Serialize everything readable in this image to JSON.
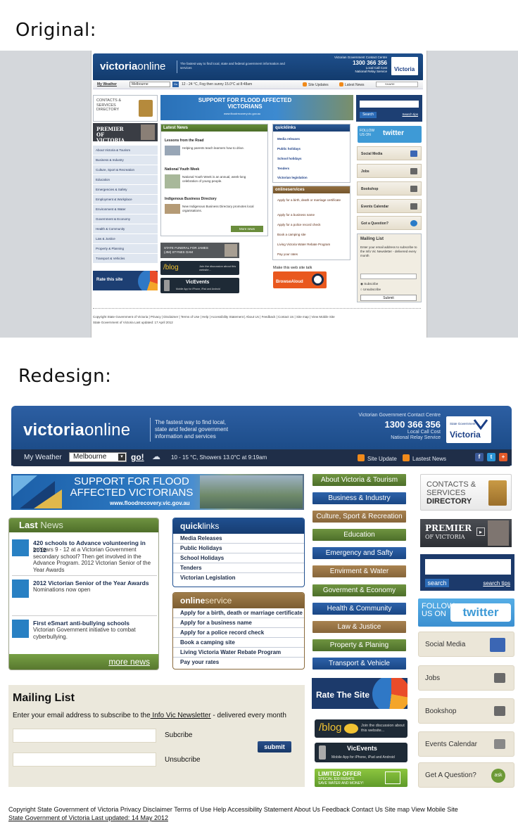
{
  "labels": {
    "original": "Original:",
    "redesign": "Redesign:"
  },
  "original": {
    "logo_bold": "victoria",
    "logo_light": "online",
    "tagline": "The fastest way to find local, state and federal government information and services",
    "contact_title": "Victorian Government Contact Centre",
    "contact_number": "1300 366 356",
    "contact_line1": "Local Call Cost",
    "contact_line2": "National Relay Service",
    "vic_logo": "Victoria",
    "nav": {
      "my_weather": "My Weather",
      "city": "Melbourne",
      "go": "Go",
      "forecast": "12 - 24 °C, Fog then sunny 15.0°C at 8:48am",
      "site_updates": "Site Updates",
      "latest_news": "Latest News",
      "share": "SHARE"
    },
    "contacts_directory": "CONTACTS & SERVICES DIRECTORY",
    "flood_banner": "SUPPORT FOR FLOOD AFFECTED VICTORIANS",
    "flood_url": "www.floodrecovery.vic.gov.au",
    "search_button": "Search",
    "search_tips": "Search tips",
    "premier": "PREMIER OF VICTORIA",
    "left_nav": [
      "About Victoria & Tourism",
      "Business & Industry",
      "Culture, Sport & Recreation",
      "Education",
      "Emergencies & Safety",
      "Employment & Workplace",
      "Environment & Water",
      "Government & Economy",
      "Health & Community",
      "Law & Justice",
      "Property & Planning",
      "Transport & Vehicles"
    ],
    "rate_site": "Rate this site",
    "latest_news_head": "Latest News",
    "news": [
      {
        "title": "Lessons from the Road",
        "body": "Helping parents teach learners how to drive."
      },
      {
        "title": "National Youth Week",
        "body": "National Youth Week is an annual, week-long celebration of young people."
      },
      {
        "title": "Indigenous Business Directory",
        "body": "New Indigenous Business Directory promotes local organisations."
      }
    ],
    "more_news": "More news",
    "state_funeral": "STATE FUNERAL FOR JAMES (JIM) STYNES OAM",
    "blog": "/blog",
    "blog_sub": "Join the discussion about this website...",
    "vicevents": "VicEvents",
    "vicevents_sub": "Mobile App for iPhone, iPad and Android",
    "quicklinks_head": "quicklinks",
    "quicklinks": [
      "Media releases",
      "Public holidays",
      "School holidays",
      "Tenders",
      "Victorian legislation"
    ],
    "onlineservices_head": "onlineservices",
    "onlineservices": [
      "Apply for a birth, death or marriage certificate",
      "Apply for a business name",
      "Apply for a police record check",
      "Book a camping site",
      "Living Victoria Water Rebate Program",
      "Pay your rates"
    ],
    "talk": "Make this web site talk",
    "browsealoud": "BrowseAloud",
    "follow": "FOLLOW US ON",
    "twitter": "twitter",
    "right_items": [
      "Social Media",
      "Jobs",
      "Bookshop",
      "Events Calendar",
      "Got a Question?"
    ],
    "mailing_list_head": "Mailing List",
    "mailing_text": "Enter your email address to subscribe to the Info Vic Newsletter - delivered every month",
    "subscribe": "Subscribe",
    "unsubscribe": "Unsubscribe",
    "submit": "Submit",
    "footer1": "Copyright State Government of Victoria | Privacy | Disclaimer | Terms of Use | Help | Accessibility Statement | About Us | Feedback | Contact Us | Site map | View Mobile Site",
    "footer2": "State Government of Victoria Last updated: 17 April 2012"
  },
  "redesign": {
    "logo_bold": "victoria",
    "logo_light": "online",
    "tagline": "The fastest way to find local, state and federal government information and services",
    "contact_title": "Victorian Government Contact Centre",
    "contact_number": "1300 366 356",
    "contact_line1": "Local Call Cost",
    "contact_line2": "National Relay Service",
    "vic_small": "State Government",
    "vic_logo": "Victoria",
    "nav": {
      "my_weather": "My Weather",
      "city": "Melbourne",
      "go": "go!",
      "forecast": "10 - 15 °C, Showers 13.0°C at 9:19am",
      "site_update": "Site Update",
      "latest_news": "Lastest News"
    },
    "flood_banner_line1": "SUPPORT FOR FLOOD",
    "flood_banner_line2": "AFFECTED VICTORIANS",
    "flood_url": "www.floodrecovery.vic.gov.au",
    "categories": [
      {
        "label": "About Victoria & Tourism",
        "color": "green"
      },
      {
        "label": "Business & Industry",
        "color": "blue"
      },
      {
        "label": "Culture, Sport & Recreation",
        "color": "brown"
      },
      {
        "label": "Education",
        "color": "green"
      },
      {
        "label": "Emergency and Safty",
        "color": "blue"
      },
      {
        "label": "Envirment & Water",
        "color": "brown"
      },
      {
        "label": "Goverment & Economy",
        "color": "green"
      },
      {
        "label": "Health & Community",
        "color": "blue"
      },
      {
        "label": "Law & Justice",
        "color": "brown"
      },
      {
        "label": "Property & Planing",
        "color": "green"
      },
      {
        "label": "Transport & Vehicle",
        "color": "blue"
      }
    ],
    "contacts_directory_line1": "CONTACTS &",
    "contacts_directory_line2": "SERVICES",
    "contacts_directory_line3": "DIRECTORY",
    "premier_line1": "PREMIER",
    "premier_line2": "OF VICTORIA",
    "search_button": "search",
    "search_tips": "search tips",
    "follow_line1": "FOLLOW",
    "follow_line2": "US ON",
    "twitter": "twitter",
    "side_items": [
      "Social Media",
      "Jobs",
      "Bookshop",
      "Events Calendar",
      "Get A Question?"
    ],
    "ask": "ask",
    "last_news_bold": "Last",
    "last_news_light": "News",
    "news": [
      {
        "title": "420 schools to Advance volunteering in 2012",
        "body": "In Years 9 - 12 at a Victorian Government secondary school? Then get involved in the Advance Program. 2012 Victorian Senior of the Year Awards"
      },
      {
        "title": "2012 Victorian Senior of the Year Awards",
        "body": "Nominations now open"
      },
      {
        "title": "First eSmart anti-bullying schools",
        "body": "Victorian Government initiative to combat cyberbullying."
      }
    ],
    "more_news": "more news",
    "quicklinks_bold": "quick",
    "quicklinks_light": "links",
    "quicklinks": [
      "Media Releases",
      "Public Holidays",
      "School Holidays",
      "Tenders",
      "Victorian Legislation"
    ],
    "onlineservice_bold": "online",
    "onlineservice_light": "service",
    "onlineservices": [
      "Apply for a birth, death or marriage certificate",
      "Apply for a business name",
      "Apply for a police record check",
      "Book a camping site",
      "Living Victoria Water Rebate Program",
      "Pay your rates"
    ],
    "rate_site": "Rate The Site",
    "blog": "/blog",
    "blog_sub": "Join the discussion about this website...",
    "vicevents": "VicEvents",
    "vicevents_sub": "Mobile App for iPhone, iPad and Android",
    "limited_offer": "LIMITED OFFER",
    "limited_sub1": "SPECIAL $30 REBATE",
    "limited_sub2": "SAVE WATER AND MONEY!",
    "mailing_list_head": "Mailing List",
    "mailing_text_pre": "Enter your email address to subscribe to the",
    "mailing_text_link": " Info Vic Newsletter",
    "mailing_text_post": " - delivered every month",
    "subscribe": "Subcribe",
    "unsubscribe": "Unsubcribe",
    "submit": "submit",
    "footer1": "Copyright State Government of Victoria Privacy Disclaimer Terms of Use Help Accessibility Statement About Us Feedback Contact Us Site map View Mobile Site",
    "footer2": "State Government of Victoria Last updated: 14 May 2012"
  },
  "colors": {
    "header_blue": "#1b4a86",
    "nav_dark": "#1f2e48",
    "green": "#5b8033",
    "brown": "#93713f",
    "accent_blue": "#2880c3",
    "cream": "#ebe8dc"
  }
}
